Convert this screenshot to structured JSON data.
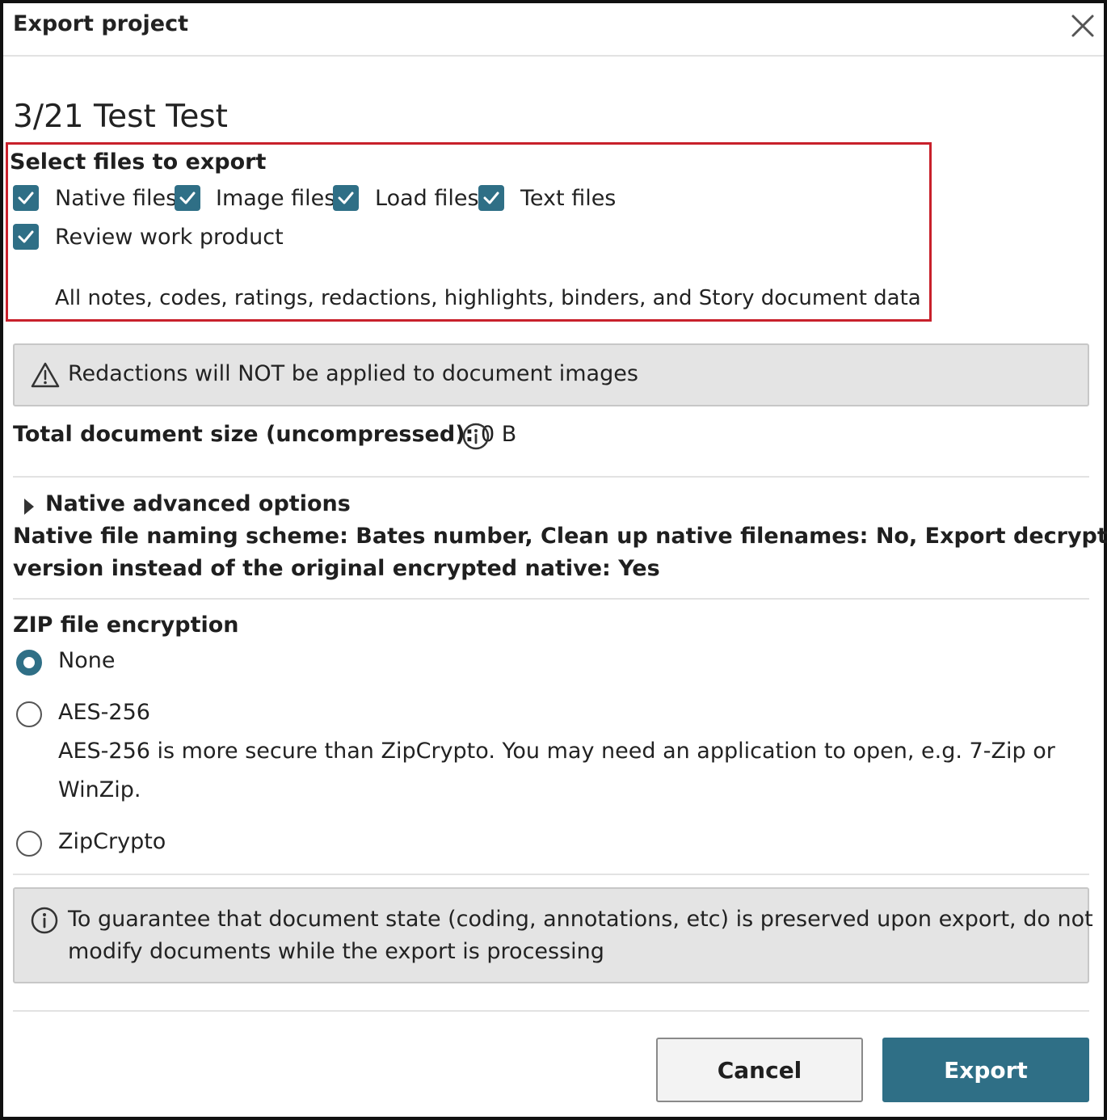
{
  "dialog": {
    "title": "Export project",
    "close_icon": "close-icon"
  },
  "project": {
    "name": "3/21 Test Test"
  },
  "select_files": {
    "heading": "Select files to export",
    "options": [
      {
        "label": "Native files",
        "checked": true
      },
      {
        "label": "Image files",
        "checked": true
      },
      {
        "label": "Load files",
        "checked": true
      },
      {
        "label": "Text files",
        "checked": true
      },
      {
        "label": "Review work product",
        "checked": true
      }
    ],
    "review_description": "All notes, codes, ratings, redactions, highlights, binders, and Story document data",
    "highlight_color": "#c8202b"
  },
  "warning": {
    "icon": "warning-icon",
    "text": "Redactions will NOT be applied to document images"
  },
  "size": {
    "label": "Total document size (uncompressed):",
    "value": "0 B",
    "icon": "info-icon"
  },
  "native_options": {
    "toggle_label": "Native advanced options",
    "expanded": false,
    "summary_line1": "Native file naming scheme: Bates number, Clean up native filenames: No, Export decrypted",
    "summary_line2": "version instead of the original encrypted native: Yes"
  },
  "zip_encryption": {
    "heading": "ZIP file encryption",
    "options": [
      {
        "label": "None",
        "selected": true
      },
      {
        "label": "AES-256",
        "selected": false
      },
      {
        "label": "ZipCrypto",
        "selected": false
      }
    ],
    "aes_description_line1": "AES-256 is more secure than ZipCrypto. You may need an application to open, e.g. 7-Zip or",
    "aes_description_line2": "WinZip."
  },
  "info_notice": {
    "icon": "info-icon",
    "line1": "To guarantee that document state (coding, annotations, etc) is preserved upon export, do not",
    "line2": "modify documents while the export is processing"
  },
  "footer": {
    "cancel_label": "Cancel",
    "export_label": "Export"
  },
  "colors": {
    "accent": "#2f6f86",
    "alert_bg": "#e4e4e4"
  }
}
